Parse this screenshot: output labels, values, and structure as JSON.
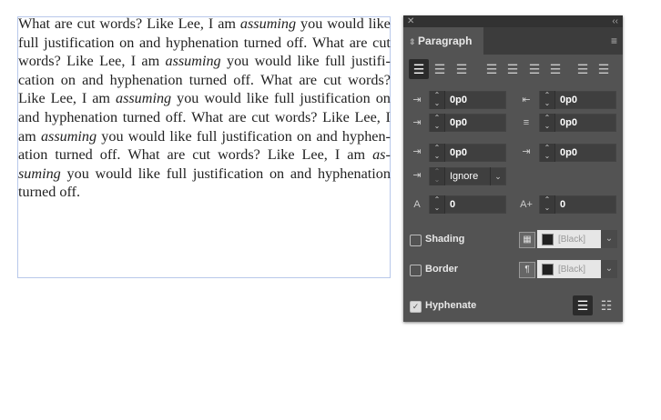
{
  "text_lines": [
    [
      {
        "t": "What are cut words? Like Lee, I am "
      },
      {
        "t": "assuming",
        "i": true
      },
      {
        "t": " you would like"
      }
    ],
    [
      {
        "t": "full justification on and hyphenation turned off. What are cut"
      }
    ],
    [
      {
        "t": "words? Like Lee, I am "
      },
      {
        "t": "assuming",
        "i": true
      },
      {
        "t": " you would like full justifi-"
      }
    ],
    [
      {
        "t": "cation on and hyphenation turned off. What are cut words?"
      }
    ],
    [
      {
        "t": "Like Lee, I am "
      },
      {
        "t": "assuming",
        "i": true
      },
      {
        "t": " you would like full justification on"
      }
    ],
    [
      {
        "t": "and hyphenation turned off. What are cut words? Like Lee, I"
      }
    ],
    [
      {
        "t": "am "
      },
      {
        "t": "assuming",
        "i": true
      },
      {
        "t": " you would like full justification on and hyphen-"
      }
    ],
    [
      {
        "t": "ation turned off. What are cut words? Like Lee, I am "
      },
      {
        "t": "as-",
        "i": true
      }
    ],
    [
      {
        "t": "suming",
        "i": true
      },
      {
        "t": " you would like full justification on and hyphenation"
      }
    ],
    [
      {
        "t": "turned off."
      }
    ]
  ],
  "panel": {
    "close": "✕",
    "collapse": "‹‹",
    "title": "Paragraph",
    "menu": "≡",
    "left_indent": "0p0",
    "right_indent": "0p0",
    "first_line_indent": "0p0",
    "last_line_indent": "0p0",
    "space_before": "0p0",
    "space_after": "0p0",
    "align_to_grid": "Ignore",
    "drop_cap_lines": "0",
    "drop_cap_chars": "0",
    "shading_label": "Shading",
    "shading_color": "[Black]",
    "shading_checked": false,
    "border_label": "Border",
    "border_color": "[Black]",
    "border_checked": false,
    "hyphenate_label": "Hyphenate",
    "hyphenate_checked": true
  }
}
